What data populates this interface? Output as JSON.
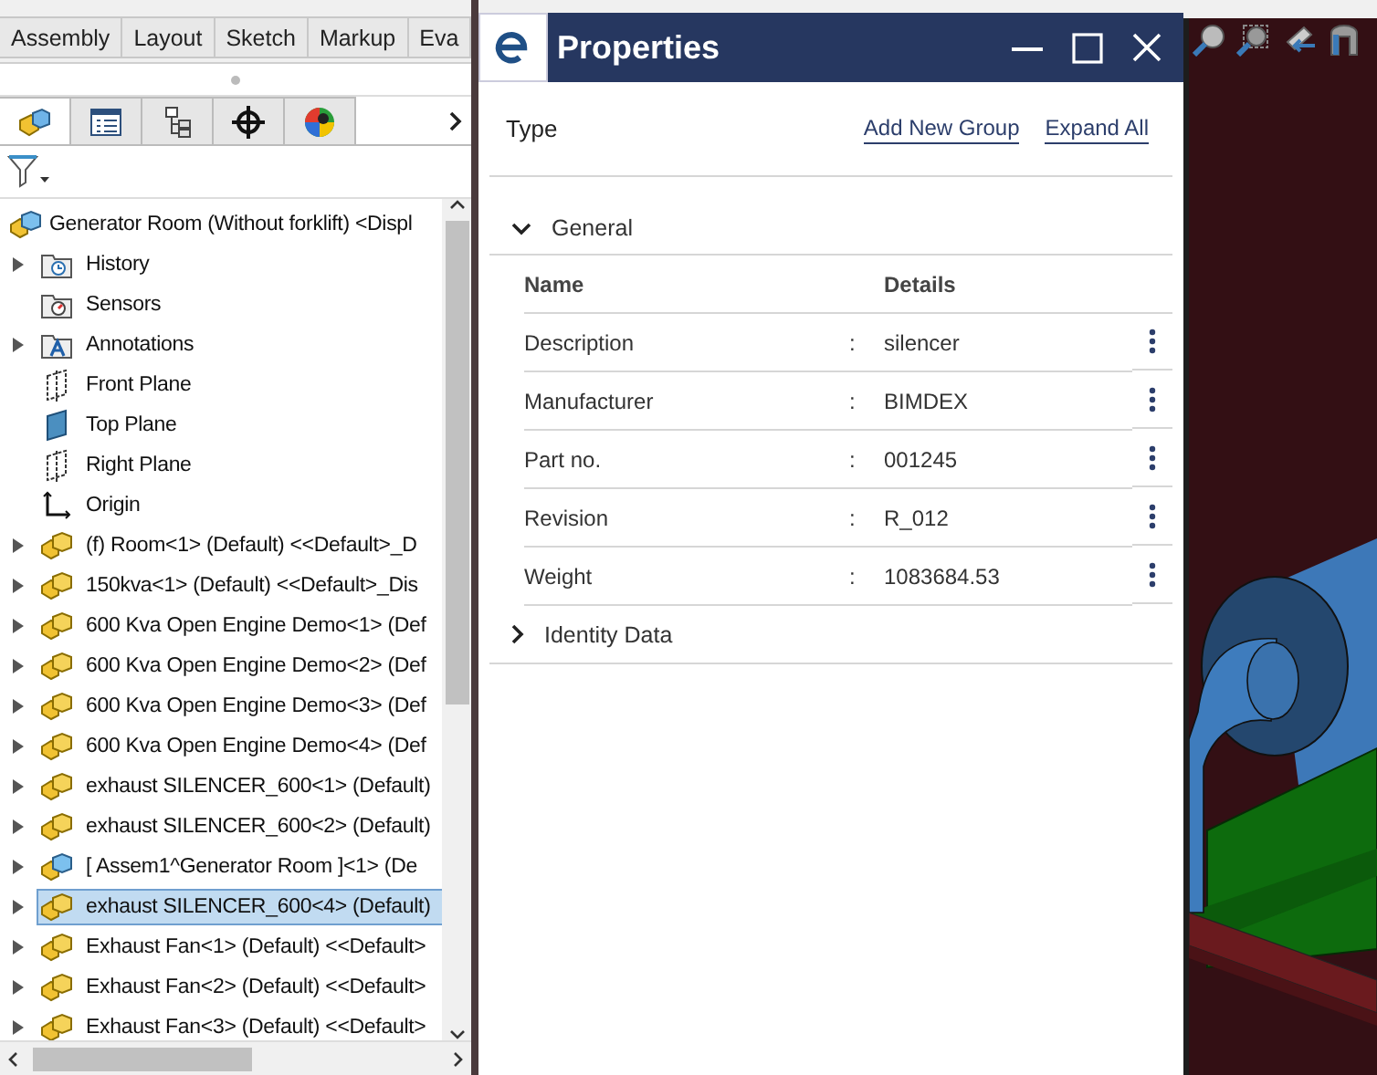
{
  "ribbon_tabs": [
    {
      "label": "Assembly",
      "selected": false
    },
    {
      "label": "Layout",
      "selected": false
    },
    {
      "label": "Sketch",
      "selected": false
    },
    {
      "label": "Markup",
      "selected": false
    },
    {
      "label": "Eva",
      "selected": false
    }
  ],
  "panel_tabs": [
    {
      "kind": "feature-tree",
      "selected": true
    },
    {
      "kind": "property-manager",
      "selected": false
    },
    {
      "kind": "configuration-manager",
      "selected": false
    },
    {
      "kind": "dimxpert",
      "selected": false
    },
    {
      "kind": "display-manager",
      "selected": false
    }
  ],
  "feature_tree": {
    "items": [
      {
        "label": "Generator Room (Without forklift) <Displ",
        "kind": "assembly",
        "selected": false,
        "children": [
          {
            "label": "History",
            "kind": "history",
            "expandable": true,
            "selected": false
          },
          {
            "label": "Sensors",
            "kind": "sensors",
            "expandable": false,
            "selected": false
          },
          {
            "label": "Annotations",
            "kind": "annotations",
            "expandable": true,
            "selected": false
          },
          {
            "label": "Front Plane",
            "kind": "plane",
            "expandable": false,
            "selected": false
          },
          {
            "label": "Top Plane",
            "kind": "plane-shaded",
            "expandable": false,
            "selected": false
          },
          {
            "label": "Right Plane",
            "kind": "plane",
            "expandable": false,
            "selected": false
          },
          {
            "label": "Origin",
            "kind": "origin",
            "expandable": false,
            "selected": false
          },
          {
            "label": "(f) Room<1> (Default) <<Default>_D",
            "kind": "part",
            "expandable": true,
            "selected": false
          },
          {
            "label": "150kva<1> (Default) <<Default>_Dis",
            "kind": "part",
            "expandable": true,
            "selected": false
          },
          {
            "label": "600 Kva Open Engine Demo<1> (Def",
            "kind": "part",
            "expandable": true,
            "selected": false
          },
          {
            "label": "600 Kva Open Engine Demo<2> (Def",
            "kind": "part",
            "expandable": true,
            "selected": false
          },
          {
            "label": "600 Kva Open Engine Demo<3> (Def",
            "kind": "part",
            "expandable": true,
            "selected": false
          },
          {
            "label": "600 Kva Open Engine Demo<4> (Def",
            "kind": "part",
            "expandable": true,
            "selected": false
          },
          {
            "label": "exhaust SILENCER_600<1> (Default)",
            "kind": "part",
            "expandable": true,
            "selected": false
          },
          {
            "label": "exhaust SILENCER_600<2> (Default)",
            "kind": "part",
            "expandable": true,
            "selected": false
          },
          {
            "label": "[ Assem1^Generator Room ]<1> (De",
            "kind": "assembly",
            "expandable": true,
            "selected": false
          },
          {
            "label": "exhaust SILENCER_600<4> (Default)",
            "kind": "part",
            "expandable": true,
            "selected": true
          },
          {
            "label": "Exhaust Fan<1> (Default) <<Default>",
            "kind": "part",
            "expandable": true,
            "selected": false
          },
          {
            "label": "Exhaust Fan<2> (Default) <<Default>",
            "kind": "part",
            "expandable": true,
            "selected": false
          },
          {
            "label": "Exhaust Fan<3> (Default) <<Default>",
            "kind": "part",
            "expandable": true,
            "selected": false
          }
        ]
      }
    ]
  },
  "properties": {
    "title": "Properties",
    "type_label": "Type",
    "links": [
      "Add New Group",
      "Expand All"
    ],
    "groups": [
      {
        "title": "General",
        "expanded": true,
        "columns": [
          "Name",
          "Details"
        ],
        "rows": [
          {
            "name": "Description",
            "separator": ":",
            "value": "silencer"
          },
          {
            "name": "Manufacturer",
            "separator": ":",
            "value": "BIMDEX"
          },
          {
            "name": "Part no.",
            "separator": ":",
            "value": "001245"
          },
          {
            "name": "Revision",
            "separator": ":",
            "value": "R_012"
          },
          {
            "name": "Weight",
            "separator": ":",
            "value": "1083684.53"
          }
        ]
      },
      {
        "title": "Identity Data",
        "expanded": false
      }
    ]
  }
}
